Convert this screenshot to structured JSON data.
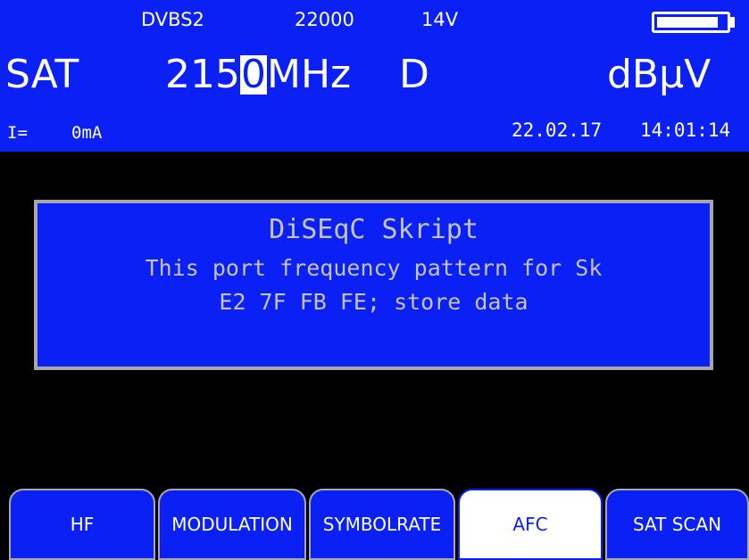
{
  "colors": {
    "header_bg": "#0a20f5",
    "screen_bg": "#000000",
    "text": "#ffffff",
    "dialog_text": "#c4c4c4",
    "dialog_border": "#a8a8a8"
  },
  "status_bar": {
    "standard": "DVBS2",
    "symbol_rate": "22000",
    "lnb_voltage": "14V",
    "battery_icon": "battery-icon",
    "battery_level": 0.9
  },
  "main_line": {
    "band": "SAT",
    "freq_prefix": "215",
    "freq_cursor_digit": "0",
    "freq_unit": "MHz",
    "mode": "D",
    "level_unit": "dBµV"
  },
  "info_line": {
    "current_label": "I=",
    "current_value": "0mA",
    "date": "22.02.17",
    "time": "14:01:14"
  },
  "dialog": {
    "title": "DiSEqC Skript",
    "line1": "This port frequency pattern for Sk",
    "line2": "E2 7F FB FE; store data"
  },
  "softkeys": [
    {
      "label": "HF",
      "active": false
    },
    {
      "label": "MODULATION",
      "active": false
    },
    {
      "label": "SYMBOLRATE",
      "active": false
    },
    {
      "label": "AFC",
      "active": true
    },
    {
      "label": "SAT SCAN",
      "active": false
    }
  ]
}
